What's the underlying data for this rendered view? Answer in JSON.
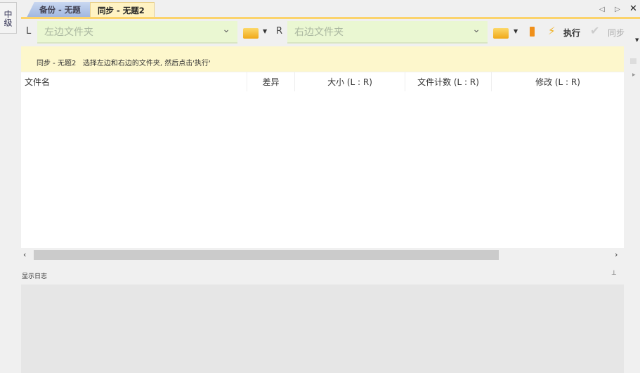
{
  "side_tab": "中级",
  "tabs": [
    {
      "label": "备份 - 无题"
    },
    {
      "label": "同步 - 无题2"
    }
  ],
  "toolbar": {
    "left_label": "L",
    "left_placeholder": "左边文件夹",
    "right_label": "R",
    "right_placeholder": "右边文件夹",
    "execute": "执行",
    "sync": "同步"
  },
  "info": {
    "title": "同步 - 无题2",
    "message": "选择左边和右边的文件夹, 然后点击'执行'"
  },
  "columns": [
    "文件名",
    "差异",
    "大小 (L : R)",
    "文件计数 (L : R)",
    "修改 (L : R)"
  ],
  "log": {
    "label": "显示日志"
  }
}
